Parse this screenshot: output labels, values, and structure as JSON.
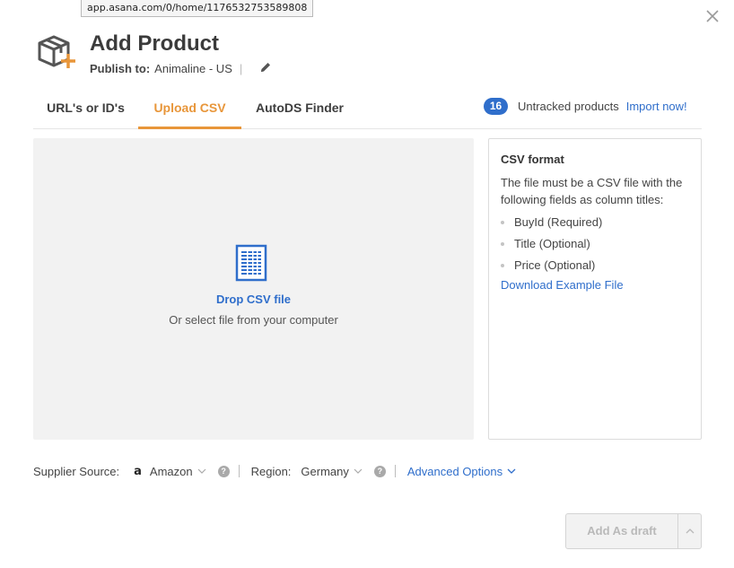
{
  "tooltip": {
    "url": "app.asana.com/0/home/1176532753589808"
  },
  "header": {
    "title": "Add Product",
    "publish_label": "Publish to:",
    "publish_store": "Animaline - US",
    "publish_separator": "|"
  },
  "tabs": [
    {
      "label": "URL's or ID's",
      "active": false
    },
    {
      "label": "Upload CSV",
      "active": true
    },
    {
      "label": "AutoDS Finder",
      "active": false
    }
  ],
  "untracked": {
    "count": "16",
    "label": "Untracked products",
    "link": "Import now!"
  },
  "dropzone": {
    "title": "Drop CSV file",
    "subtitle": "Or select file from your computer"
  },
  "csv_format": {
    "title": "CSV format",
    "description": "The file must be a CSV file with the following fields as column titles:",
    "fields": [
      "BuyId (Required)",
      "Title (Optional)",
      "Price (Optional)"
    ],
    "download_link": "Download Example File"
  },
  "options": {
    "supplier_label": "Supplier Source:",
    "supplier_icon": "a",
    "supplier_value": "Amazon",
    "region_label": "Region:",
    "region_value": "Germany",
    "help_glyph": "?",
    "advanced_label": "Advanced Options"
  },
  "footer": {
    "add_draft_label": "Add As draft"
  },
  "colors": {
    "accent": "#e8963a",
    "link": "#2f6ecb",
    "badge": "#2f6ecb"
  },
  "icons": [
    "close-icon",
    "box-add-icon",
    "pencil-icon",
    "csv-file-icon",
    "amazon-icon",
    "help-icon",
    "chevron-down-icon",
    "chevron-up-icon"
  ]
}
